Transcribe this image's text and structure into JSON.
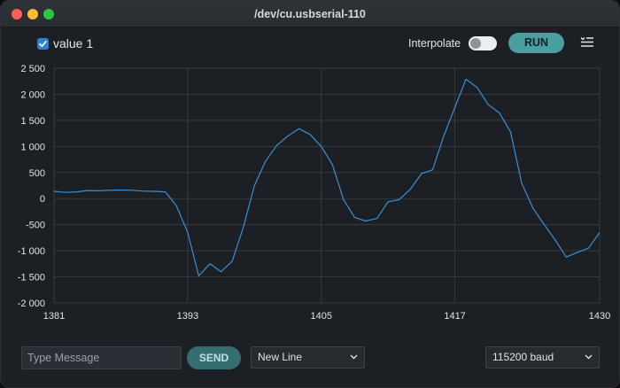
{
  "window": {
    "title": "/dev/cu.usbserial-110"
  },
  "toolbar": {
    "series_label": "value 1",
    "series_checked": true,
    "interpolate_label": "Interpolate",
    "interpolate_on": false,
    "run_label": "RUN",
    "menu_icon": "list-menu-icon"
  },
  "bottombar": {
    "message_placeholder": "Type Message",
    "send_label": "SEND",
    "line_ending": "New Line",
    "baud": "115200 baud"
  },
  "colors": {
    "accent": "#4a9ea0",
    "series": "#3b8fd6",
    "checkbox": "#2f7fd4"
  },
  "chart_data": {
    "type": "line",
    "x_ticks": [
      "1381",
      "1393",
      "1405",
      "1417",
      "1430"
    ],
    "y_ticks": [
      "2 500",
      "2 000",
      "1 500",
      "1 000",
      "500",
      "0",
      "-500",
      "-1 000",
      "-1 500",
      "-2 000"
    ],
    "xlim": [
      1381,
      1430
    ],
    "ylim": [
      -2000,
      2500
    ],
    "grid": true,
    "series": [
      {
        "x": [
          1381,
          1382,
          1383,
          1384,
          1385,
          1386,
          1387,
          1388,
          1389,
          1390,
          1391,
          1392,
          1393,
          1394,
          1395,
          1396,
          1397,
          1398,
          1399,
          1400,
          1401,
          1402,
          1403,
          1404,
          1405,
          1406,
          1407,
          1408,
          1409,
          1410,
          1411,
          1412,
          1413,
          1414,
          1415,
          1416,
          1417,
          1418,
          1419,
          1420,
          1421,
          1422,
          1423,
          1424,
          1425,
          1426,
          1427,
          1428,
          1429,
          1430
        ],
        "values": [
          140,
          120,
          130,
          155,
          150,
          160,
          165,
          160,
          145,
          140,
          130,
          -140,
          -650,
          -1480,
          -1250,
          -1400,
          -1200,
          -550,
          250,
          720,
          1020,
          1200,
          1340,
          1230,
          1000,
          650,
          -20,
          -360,
          -430,
          -380,
          -60,
          -20,
          180,
          480,
          550,
          1200,
          1750,
          2290,
          2130,
          1800,
          1640,
          1280,
          300,
          -180,
          -490,
          -790,
          -1120,
          -1030,
          -950,
          -650
        ]
      }
    ]
  }
}
